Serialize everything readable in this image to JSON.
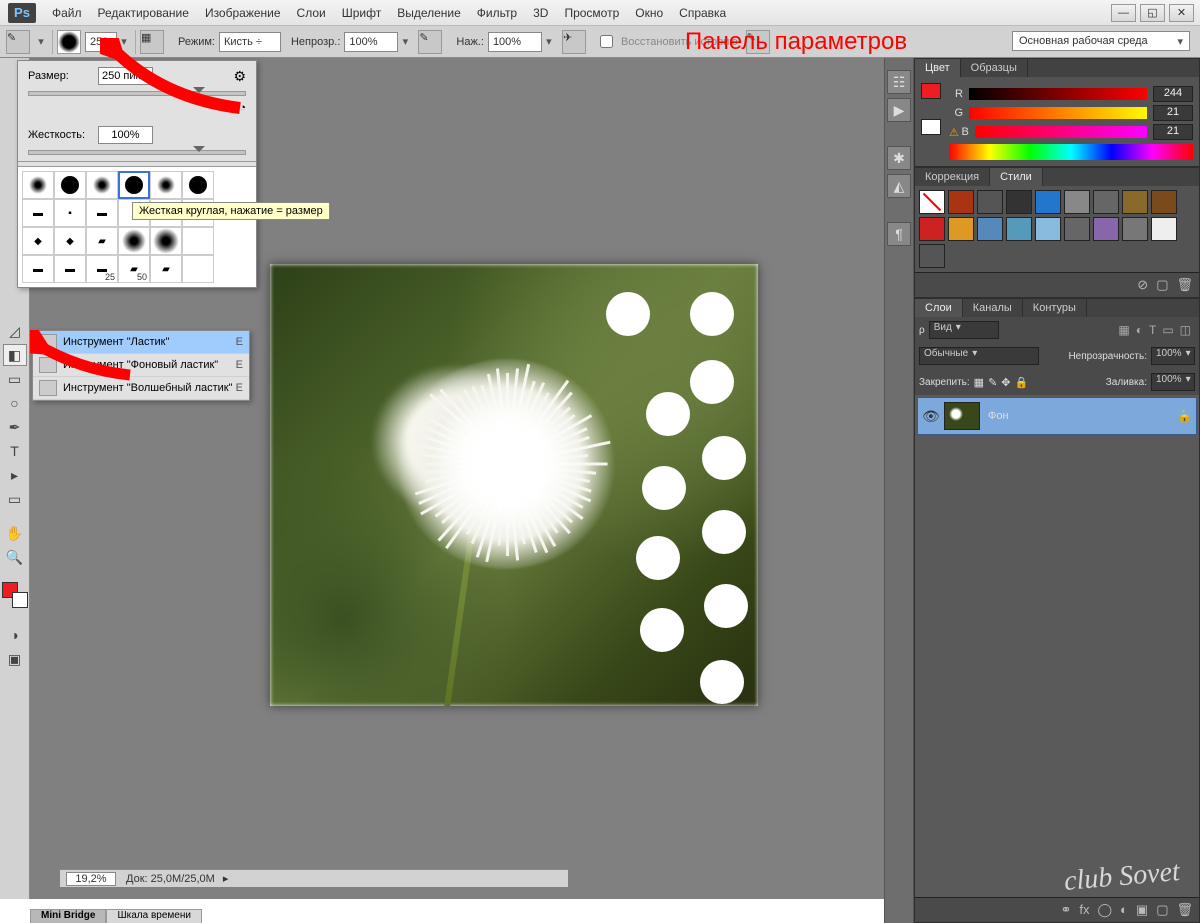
{
  "menu": {
    "items": [
      "Файл",
      "Редактирование",
      "Изображение",
      "Слои",
      "Шрифт",
      "Выделение",
      "Фильтр",
      "3D",
      "Просмотр",
      "Окно",
      "Справка"
    ]
  },
  "options": {
    "brush_size": "250",
    "mode_label": "Режим:",
    "mode_value": "Кисть",
    "opacity_label": "Непрозр.:",
    "opacity_value": "100%",
    "flow_label": "Наж.:",
    "flow_value": "100%",
    "history": "Восстановить историю",
    "annotation": "Панель параметров",
    "workspace": "Основная рабочая среда"
  },
  "brush_popup": {
    "size_label": "Размер:",
    "size_value": "250 пикс.",
    "hardness_label": "Жесткость:",
    "hardness_value": "100%",
    "tooltip": "Жесткая круглая, нажатие = размер",
    "preset_labels": [
      "",
      "",
      "",
      "",
      "",
      "",
      "",
      "",
      "",
      "",
      "",
      "",
      "",
      "",
      "",
      "",
      "",
      "",
      "",
      "",
      "25",
      "50",
      "",
      "",
      ""
    ]
  },
  "eraser_menu": {
    "items": [
      {
        "label": "Инструмент \"Ластик\"",
        "key": "E"
      },
      {
        "label": "Инструмент \"Фоновый ластик\"",
        "key": "E"
      },
      {
        "label": "Инструмент \"Волшебный ластик\"",
        "key": "E"
      }
    ]
  },
  "status": {
    "zoom": "19,2%",
    "doc": "Док: 25,0M/25,0M"
  },
  "bottom_tabs": [
    "Mini Bridge",
    "Шкала времени"
  ],
  "color_panel": {
    "tabs": [
      "Цвет",
      "Образцы"
    ],
    "r": "244",
    "g": "21",
    "b": "21",
    "fg": "#ee1c23",
    "bg": "#ffffff"
  },
  "styles_panel": {
    "tabs": [
      "Коррекция",
      "Стили"
    ],
    "swatches": [
      "#ffffff",
      "#aa3311",
      "#555555",
      "#333333",
      "#2277cc",
      "#888888",
      "#666666",
      "#8a6a2a",
      "#7a4a1a",
      "#cc2222",
      "#dd9922",
      "#5588bb",
      "#5599bb",
      "#88bbdd",
      "#666666",
      "#8866aa",
      "#777777",
      "#eeeeee",
      "#555555"
    ]
  },
  "layers_panel": {
    "tabs": [
      "Слои",
      "Каналы",
      "Контуры"
    ],
    "kind": "Вид",
    "blend": "Обычные",
    "opacity_label": "Непрозрачность:",
    "opacity": "100%",
    "lock_label": "Закрепить:",
    "fill_label": "Заливка:",
    "fill": "100%",
    "layer_name": "Фон"
  },
  "watermark": "club Sovet"
}
